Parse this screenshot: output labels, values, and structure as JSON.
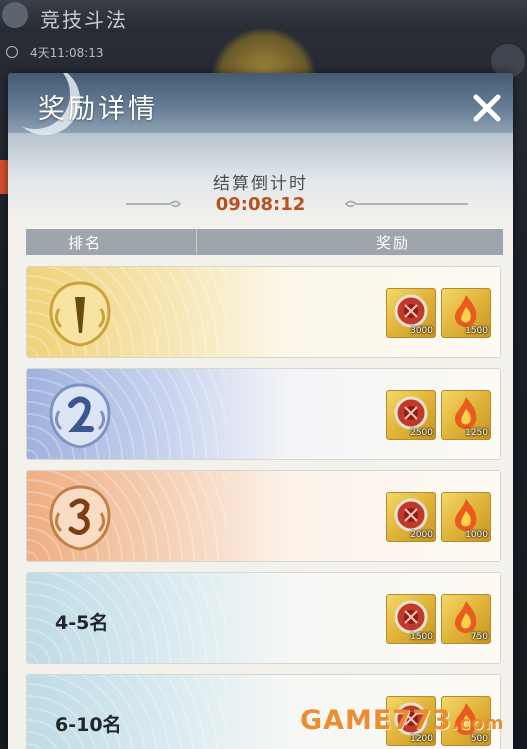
{
  "background": {
    "screen_title": "竞技斗法",
    "season_timer": "4天11:08:13"
  },
  "modal": {
    "title": "奖励详情",
    "countdown_label": "结算倒计时",
    "countdown_value": "09:08:12",
    "table_headers": {
      "rank": "排名",
      "reward": "奖励"
    },
    "rows": [
      {
        "rank": "1",
        "rank_display": "medal-1",
        "rewards": [
          {
            "icon": "red-jade-token-icon",
            "count": "3000"
          },
          {
            "icon": "flame-spirit-icon",
            "count": "1500"
          }
        ]
      },
      {
        "rank": "2",
        "rank_display": "medal-2",
        "rewards": [
          {
            "icon": "red-jade-token-icon",
            "count": "2500"
          },
          {
            "icon": "flame-spirit-icon",
            "count": "1250"
          }
        ]
      },
      {
        "rank": "3",
        "rank_display": "medal-3",
        "rewards": [
          {
            "icon": "red-jade-token-icon",
            "count": "2000"
          },
          {
            "icon": "flame-spirit-icon",
            "count": "1000"
          }
        ]
      },
      {
        "rank": "4-5名",
        "rank_display": "text",
        "rewards": [
          {
            "icon": "red-jade-token-icon",
            "count": "1500"
          },
          {
            "icon": "flame-spirit-icon",
            "count": "750"
          }
        ]
      },
      {
        "rank": "6-10名",
        "rank_display": "text",
        "rewards": [
          {
            "icon": "red-jade-token-icon",
            "count": "1200"
          },
          {
            "icon": "flame-spirit-icon",
            "count": "500"
          }
        ]
      }
    ]
  },
  "watermark": {
    "main": "GAME773",
    "suffix": ".com"
  },
  "colors": {
    "gold_row": "#f0d27a",
    "silver_row": "#9fb2de",
    "bronze_row": "#eeae82",
    "plain_row": "#bfdbe6",
    "countdown": "#b8501f"
  }
}
